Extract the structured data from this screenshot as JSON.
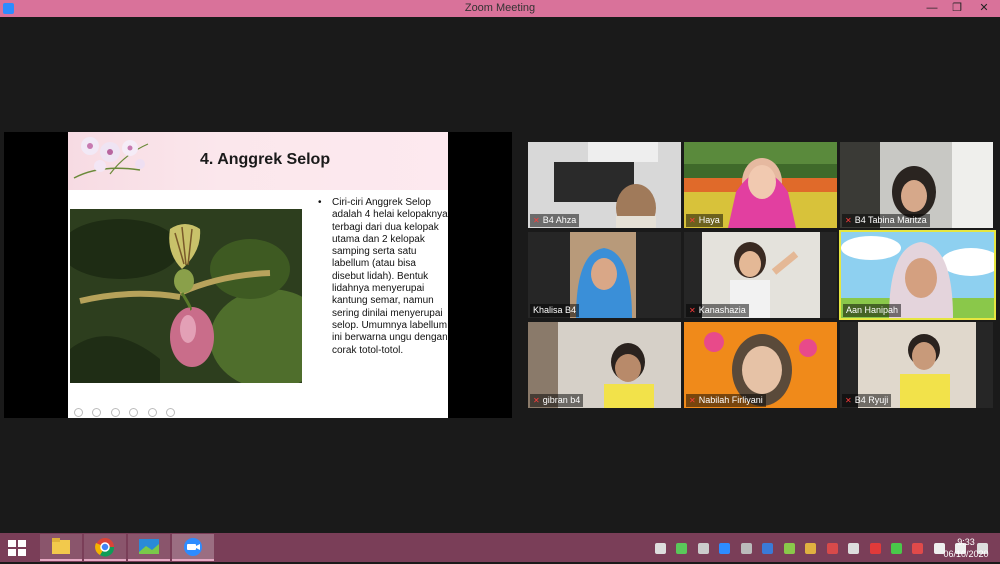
{
  "window": {
    "title": "Zoom Meeting",
    "minimize": "—",
    "restore": "❐",
    "close": "✕"
  },
  "slide": {
    "title": "4. Anggrek Selop",
    "bullet": "•",
    "body": "Ciri-ciri Anggrek Selop adalah 4 helai kelopaknya terbagi dari dua kelopak utama dan 2 kelopak samping serta satu labellum (atau bisa disebut lidah). Bentuk lidahnya menyerupai kantung semar, namun sering dinilai menyerupai selop. Umumnya labellum ini berwarna ungu dengan corak totol-totol."
  },
  "participants": [
    {
      "name": "B4 Ahza",
      "muted": true
    },
    {
      "name": "Haya",
      "muted": true
    },
    {
      "name": "B4 Tabina Maritza",
      "muted": true
    },
    {
      "name": "Khalisa B4",
      "muted": false
    },
    {
      "name": "Kanashazia",
      "muted": true
    },
    {
      "name": "Aan Hanipah",
      "muted": false,
      "active": true
    },
    {
      "name": "gibran b4",
      "muted": true
    },
    {
      "name": "Nabilah Firliyani",
      "muted": true
    },
    {
      "name": "B4 Ryuji",
      "muted": true
    }
  ],
  "icons": {
    "mic_muted": "mic-muted-icon"
  },
  "taskbar": {
    "time": "9:33",
    "date": "06/10/2020"
  },
  "colors": {
    "titlebar": "#d9729a",
    "taskbar": "#7a3e58",
    "active_speaker": "#e6e640"
  }
}
